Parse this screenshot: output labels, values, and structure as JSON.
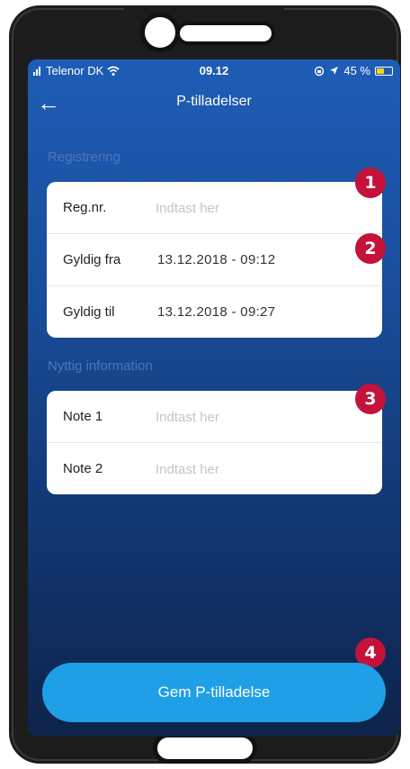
{
  "status_bar": {
    "carrier": "Telenor DK",
    "time": "09.12",
    "battery_percent": "45 %",
    "icons": [
      "signal-icon",
      "wifi-icon",
      "rotation-lock-icon",
      "location-icon",
      "battery-icon"
    ]
  },
  "nav": {
    "back_icon": "back-arrow-icon",
    "title": "P-tilladelser"
  },
  "registrering": {
    "section_title": "Registrering",
    "rows": [
      {
        "label": "Reg.nr.",
        "placeholder": "Indtast her"
      },
      {
        "label": "Gyldig fra",
        "value": "13.12.2018 - 09:12"
      },
      {
        "label": "Gyldig til",
        "value": "13.12.2018 - 09:27"
      }
    ]
  },
  "nyttig_information": {
    "section_title": "Nyttig information",
    "rows": [
      {
        "label": "Note 1",
        "placeholder": "Indtast her"
      },
      {
        "label": "Note 2",
        "placeholder": "Indtast her"
      }
    ]
  },
  "save_button": {
    "label": "Gem P-tilladelse"
  },
  "badges": [
    "1",
    "2",
    "3",
    "4"
  ],
  "colors": {
    "badge": "#c4123a",
    "button": "#1f9fe6",
    "screen_top": "#1e5db6",
    "screen_bottom": "#0d234a"
  }
}
